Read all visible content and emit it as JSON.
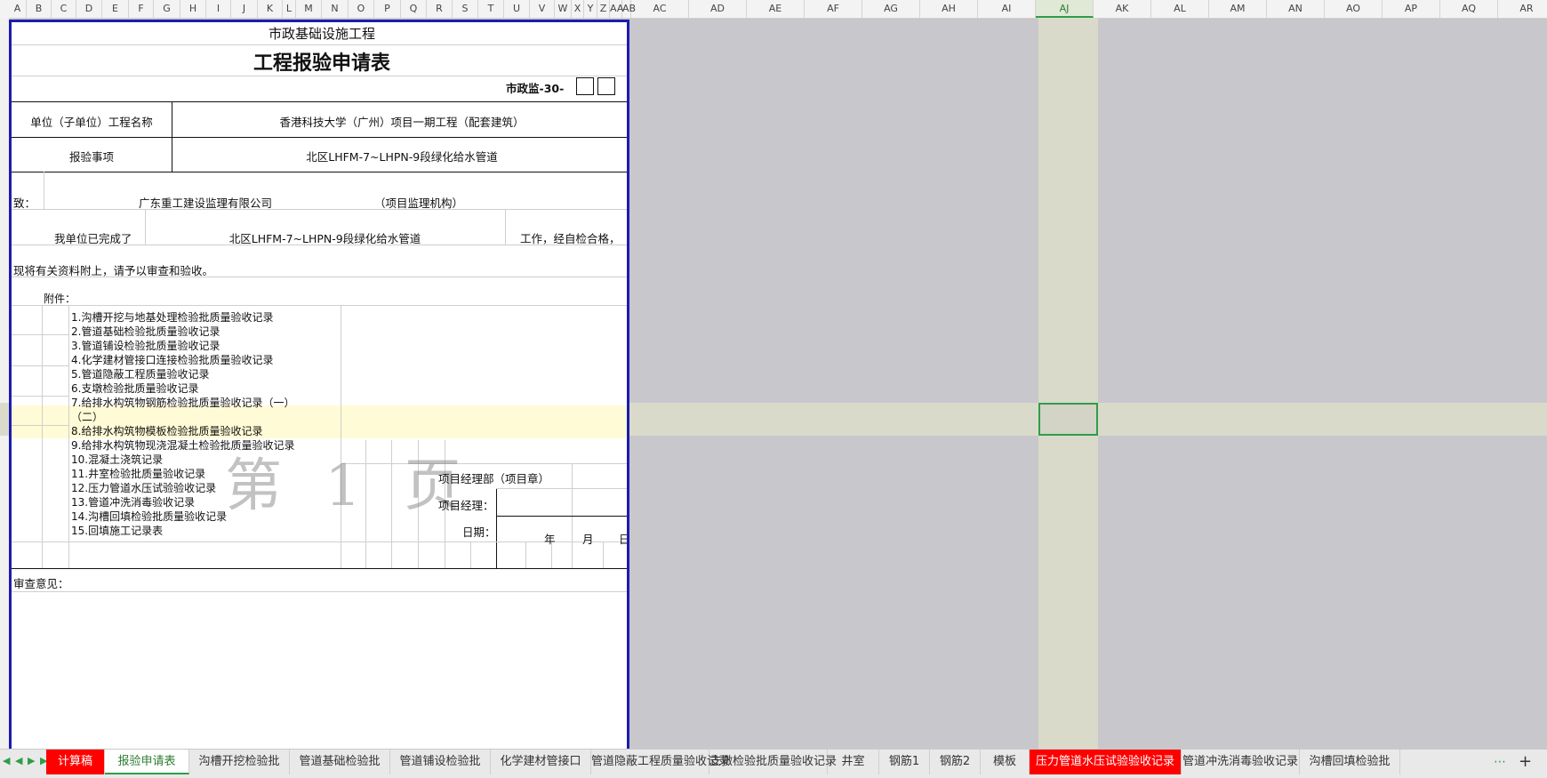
{
  "columns": {
    "narrow": [
      "A",
      "B",
      "C",
      "D",
      "E",
      "F",
      "G",
      "H",
      "I",
      "J",
      "K",
      "L",
      "M",
      "N",
      "O",
      "P",
      "Q",
      "R",
      "S",
      "T",
      "U",
      "V",
      "W",
      "X",
      "Y",
      "Z",
      "AA",
      "AB"
    ],
    "wide": [
      "AC",
      "AD",
      "AE",
      "AF",
      "AG",
      "AH",
      "AI",
      "AJ",
      "AK",
      "AL",
      "AM",
      "AN",
      "AO",
      "AP",
      "AQ",
      "AR"
    ],
    "active": "AJ"
  },
  "doc": {
    "category": "市政基础设施工程",
    "title": "工程报验申请表",
    "code_label": "市政监-30-",
    "unit_label": "单位（子单位）工程名称",
    "unit_value": "香港科技大学（广州）项目一期工程（配套建筑）",
    "item_label": "报验事项",
    "item_value": "北区LHFM-7~LHPN-9段绿化给水管道",
    "to_label": "致：",
    "to_value": "广东重工建设监理有限公司",
    "to_suffix": "（项目监理机构）",
    "done_prefix": "我单位已完成了",
    "done_value": "北区LHFM-7~LHPN-9段绿化给水管道",
    "done_suffix": "工作，经自检合格，",
    "submit_text": "现将有关资料附上，请予以审查和验收。",
    "attach_label": "附件：",
    "attachments": [
      "1.沟槽开挖与地基处理检验批质量验收记录",
      "2.管道基础检验批质量验收记录",
      "3.管道铺设检验批质量验收记录",
      "4.化学建材管接口连接检验批质量验收记录",
      "5.管道隐蔽工程质量验收记录",
      "6.支墩检验批质量验收记录",
      "7.给排水构筑物钢筋检验批质量验收记录（一）",
      "（二）",
      "8.给排水构筑物模板检验批质量验收记录",
      "9.给排水构筑物现浇混凝土检验批质量验收记录",
      "10.混凝土浇筑记录",
      "11.井室检验批质量验收记录",
      "12.压力管道水压试验验收记录",
      "13.管道冲洗消毒验收记录",
      "14.沟槽回填检验批质量验收记录",
      "15.回填施工记录表"
    ],
    "dept_label": "项目经理部（项目章）",
    "manager_label": "项目经理：",
    "date_label": "日期：",
    "year": "年",
    "month": "月",
    "day": "日",
    "review_label": "审查意见：",
    "watermark": "第 1 页"
  },
  "tabs": [
    {
      "label": "计算稿",
      "style": "red"
    },
    {
      "label": "报验申请表",
      "style": "active"
    },
    {
      "label": "沟槽开挖检验批",
      "style": "normal"
    },
    {
      "label": "管道基础检验批",
      "style": "normal"
    },
    {
      "label": "管道铺设检验批",
      "style": "normal"
    },
    {
      "label": "化学建材管接口",
      "style": "normal"
    },
    {
      "label": "管道隐蔽工程质量验收记录",
      "style": "normal"
    },
    {
      "label": "支墩检验批质量验收记录",
      "style": "normal"
    },
    {
      "label": "井室",
      "style": "normal"
    },
    {
      "label": "钢筋1",
      "style": "normal"
    },
    {
      "label": "钢筋2",
      "style": "normal"
    },
    {
      "label": "模板",
      "style": "normal"
    },
    {
      "label": "压力管道水压试验验收记录",
      "style": "red"
    },
    {
      "label": "管道冲洗消毒验收记录",
      "style": "normal"
    },
    {
      "label": "沟槽回填检验批",
      "style": "normal"
    }
  ],
  "colors": {
    "page_border": "#1c1cb0",
    "active_green": "#2e9d48",
    "red_tab": "#ff0000",
    "highlight_row": "#fffbd6"
  }
}
